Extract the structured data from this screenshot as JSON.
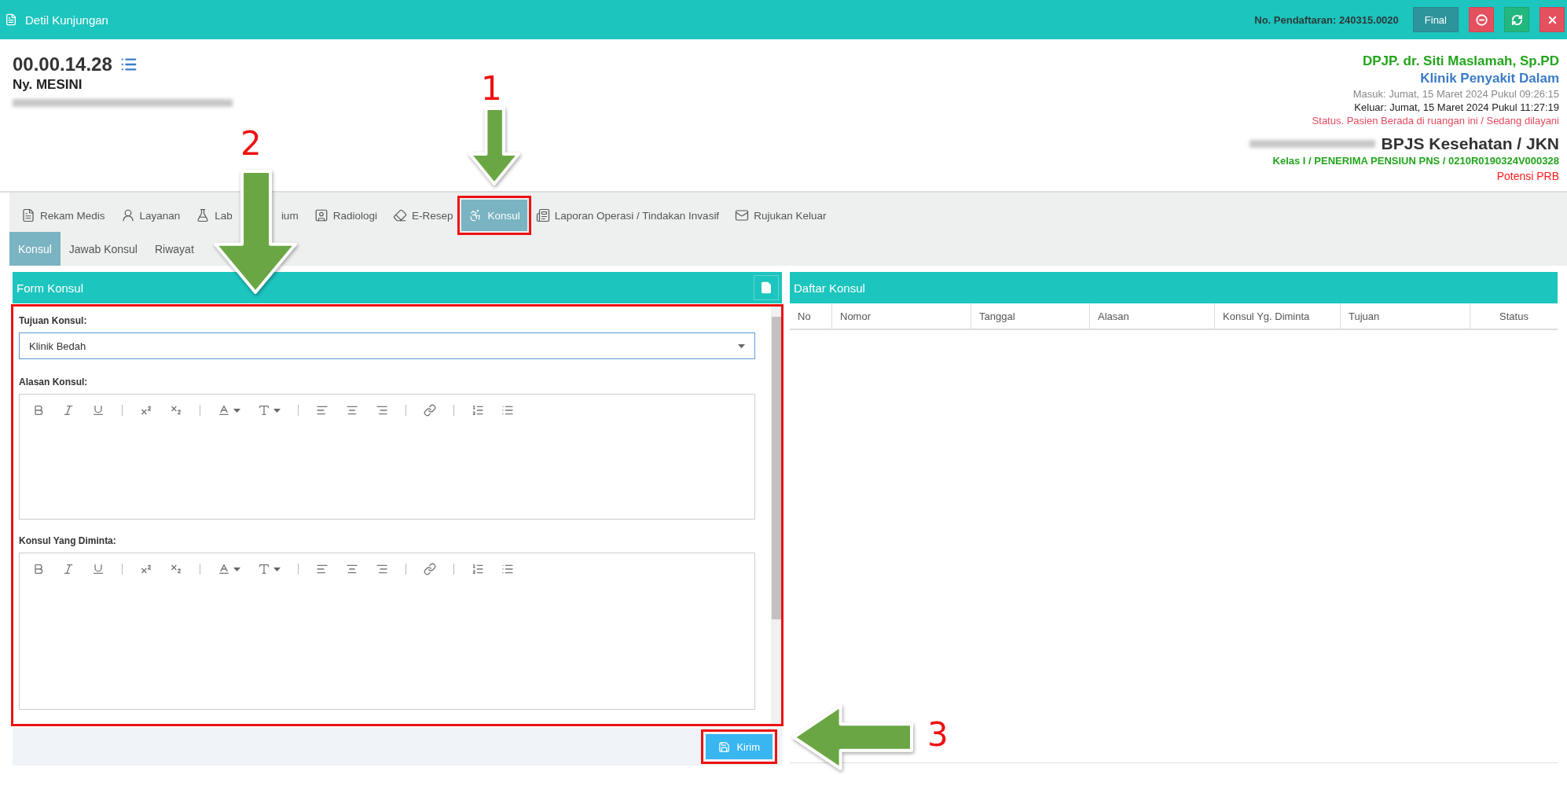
{
  "window": {
    "title": "Detil Kunjungan"
  },
  "registration": "No. Pendaftaran: 240315.0020",
  "window_buttons": [
    {
      "kind": "text",
      "label": "Final"
    },
    {
      "kind": "remove"
    },
    {
      "kind": "refresh"
    },
    {
      "kind": "close"
    }
  ],
  "patient": {
    "record_number": "00.00.14.28",
    "name": "Ny. MESINI"
  },
  "visit": {
    "doctor": "DPJP. dr. Siti Maslamah, Sp.PD",
    "clinic": "Klinik Penyakit Dalam",
    "entry": "Masuk: Jumat, 15 Maret 2024 Pukul 09:26:15",
    "exit": "Keluar: Jumat, 15 Maret 2024 Pukul 11:27:19",
    "status": "Status. Pasien Berada di ruangan ini / Sedang dilayani",
    "payer": "BPJS Kesehatan / JKN",
    "membership": "Kelas I / PENERIMA PENSIUN PNS / 0210R0190324V000328",
    "note": "Potensi PRB"
  },
  "main_tabs": [
    {
      "kind": "records",
      "label": "Rekam Medis",
      "selected": false,
      "highlighted": false
    },
    {
      "kind": "service",
      "label": "Layanan",
      "selected": false,
      "highlighted": false
    },
    {
      "kind": "lab",
      "label": "Lab",
      "label_end": "ium",
      "selected": false,
      "highlighted": false
    },
    {
      "kind": "radiology",
      "label": "Radiologi",
      "selected": false,
      "highlighted": false
    },
    {
      "kind": "prescription",
      "label": "E-Resep",
      "selected": false,
      "highlighted": false
    },
    {
      "kind": "consult",
      "label": "Konsul",
      "selected": true,
      "highlighted": true
    },
    {
      "kind": "report",
      "label": "Laporan Operasi / Tindakan Invasif",
      "selected": false,
      "highlighted": false
    },
    {
      "kind": "referral",
      "label": "Rujukan Keluar",
      "selected": false,
      "highlighted": false
    }
  ],
  "sub_tabs": [
    {
      "label": "Konsul",
      "selected": true
    },
    {
      "label": "Jawab Konsul",
      "selected": false
    },
    {
      "label": "Riwayat",
      "selected": false
    }
  ],
  "form": {
    "title": "Form Konsul",
    "highlighted": true,
    "fields": [
      {
        "kind": "select",
        "label": "Tujuan Konsul:",
        "value": "Klinik Bedah"
      },
      {
        "kind": "editor",
        "label": "Alasan Konsul:"
      },
      {
        "kind": "editor",
        "label": "Konsul Yang Diminta:"
      }
    ],
    "submit": {
      "label": "Kirim",
      "highlighted": true
    }
  },
  "list": {
    "title": "Daftar Konsul",
    "columns": [
      "No",
      "Nomor",
      "Tanggal",
      "Alasan",
      "Konsul Yg. Diminta",
      "Tujuan",
      "Status"
    ]
  },
  "annotations": [
    {
      "number": "1"
    },
    {
      "number": "2"
    },
    {
      "number": "3"
    }
  ]
}
